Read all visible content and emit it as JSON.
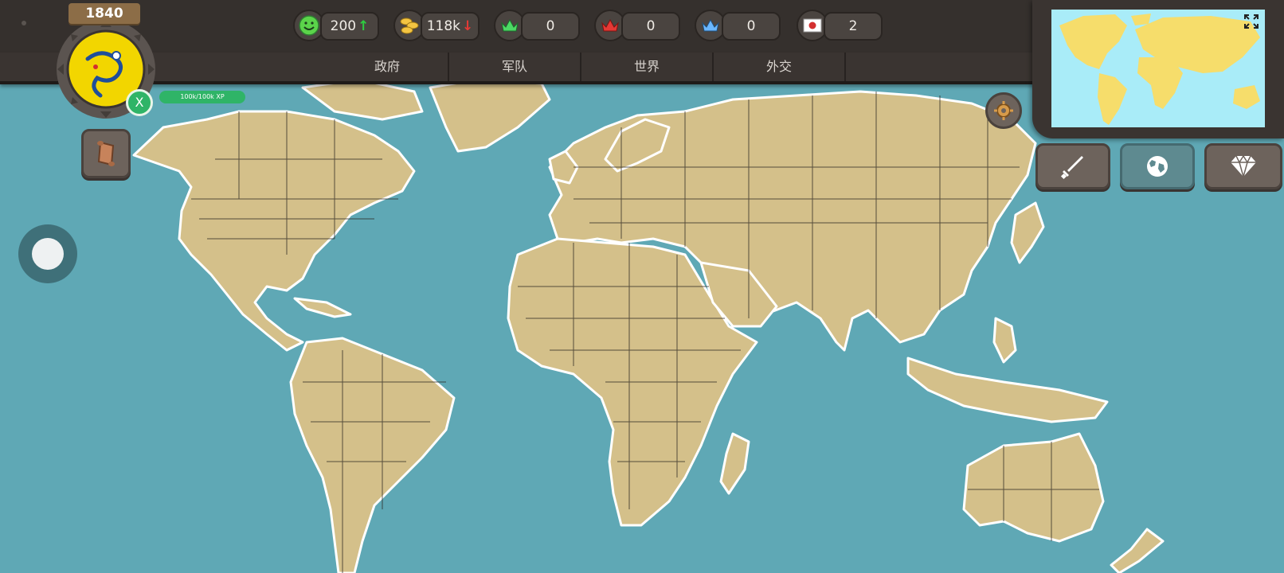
{
  "game": {
    "year": "1840",
    "xp_text": "100k/100k XP",
    "level_button": "X"
  },
  "resources": [
    {
      "id": "happiness",
      "icon": "smiley-icon",
      "value": "200",
      "trend": "up",
      "trend_color": "#2ecc40"
    },
    {
      "id": "gold",
      "icon": "coins-icon",
      "value": "118k",
      "trend": "down",
      "trend_color": "#e53935"
    },
    {
      "id": "green-crown",
      "icon": "green-crown-icon",
      "value": "0"
    },
    {
      "id": "red-crown",
      "icon": "red-crown-icon",
      "value": "0"
    },
    {
      "id": "blue-crown",
      "icon": "blue-crown-icon",
      "value": "0"
    },
    {
      "id": "flag",
      "icon": "japan-flag-icon",
      "value": "2"
    }
  ],
  "tabs": [
    "政府",
    "军队",
    "世界",
    "外交"
  ],
  "right_buttons": [
    "sword-icon",
    "globe-icon",
    "diamond-icon"
  ],
  "colors": {
    "ocean": "#5fa8b5",
    "land": "#d4c08a",
    "border": "#2b2620",
    "panel": "#35302d",
    "minimap_ocean": "#a9ecf8",
    "minimap_land": "#f6dd6b",
    "xp_green": "#2fb467"
  }
}
